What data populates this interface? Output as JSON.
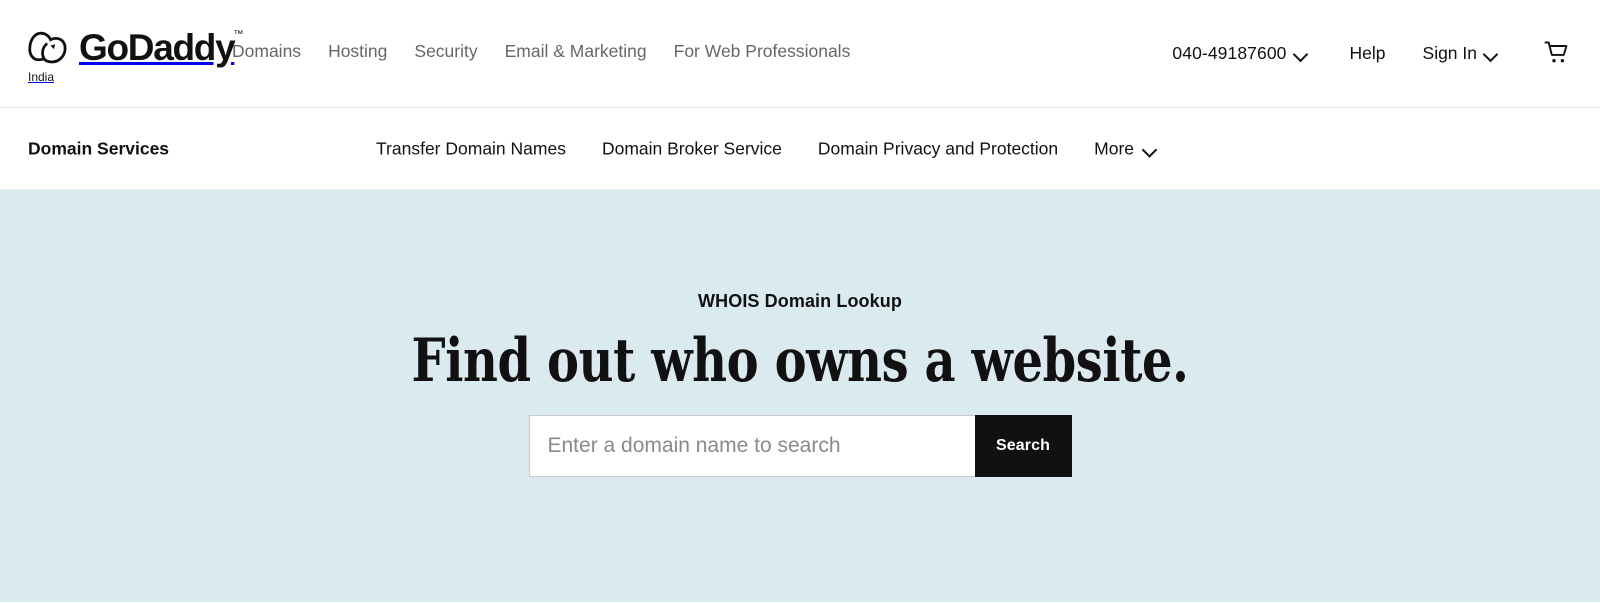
{
  "header": {
    "brand": {
      "logo_icon": "godaddy-heart-logo-icon",
      "wordmark": "GoDaddy",
      "trademark": "™",
      "locale": "India"
    },
    "nav": [
      {
        "label": "Domains"
      },
      {
        "label": "Hosting"
      },
      {
        "label": "Security"
      },
      {
        "label": "Email & Marketing"
      },
      {
        "label": "For Web Professionals"
      }
    ],
    "phone": "040-49187600",
    "help_label": "Help",
    "sign_in_label": "Sign In",
    "cart_icon": "shopping-cart-icon",
    "chevron_icon": "chevron-down-icon"
  },
  "sub_header": {
    "title": "Domain Services",
    "links": [
      {
        "label": "Transfer Domain Names"
      },
      {
        "label": "Domain Broker Service"
      },
      {
        "label": "Domain Privacy and Protection"
      }
    ],
    "more_label": "More",
    "more_chevron_icon": "chevron-down-icon"
  },
  "hero": {
    "eyebrow": "WHOIS Domain Lookup",
    "title": "Find out who owns a website.",
    "search": {
      "placeholder": "Enter a domain name to search",
      "value": "",
      "button_label": "Search"
    },
    "background_color": "#dbeaee"
  }
}
